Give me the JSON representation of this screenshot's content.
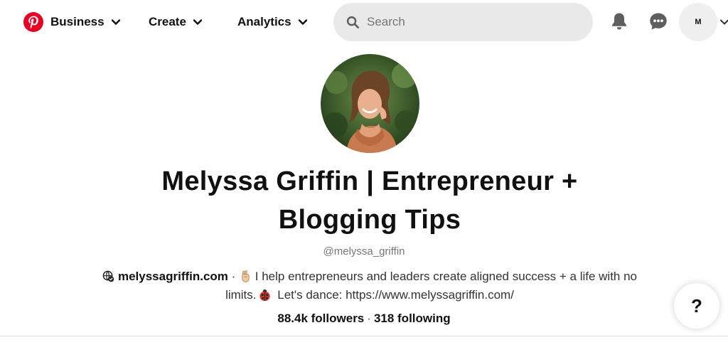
{
  "header": {
    "logo": "pinterest-logo",
    "nav": [
      {
        "label": "Business"
      },
      {
        "label": "Create"
      },
      {
        "label": "Analytics"
      }
    ],
    "search": {
      "placeholder": "Search",
      "value": ""
    },
    "account": {
      "initial": "M"
    }
  },
  "profile": {
    "name_line1": "Melyssa Griffin | Entrepreneur +",
    "name_line2": "Blogging Tips",
    "handle": "@melyssa_griffin",
    "website": "melyssagriffin.com",
    "bio_part1": " · ",
    "bio_part2": " I help entrepreneurs and leaders create aligned success + a life with no limits.",
    "bio_part3": " Let's dance: https://www.melyssagriffin.com/",
    "followers": "88.4k followers",
    "separator": "·",
    "following": "318 following"
  },
  "help": {
    "label": "?"
  },
  "colors": {
    "brand": "#e60023",
    "search_bg": "#e9e9e9",
    "text": "#111111",
    "muted": "#767676"
  }
}
